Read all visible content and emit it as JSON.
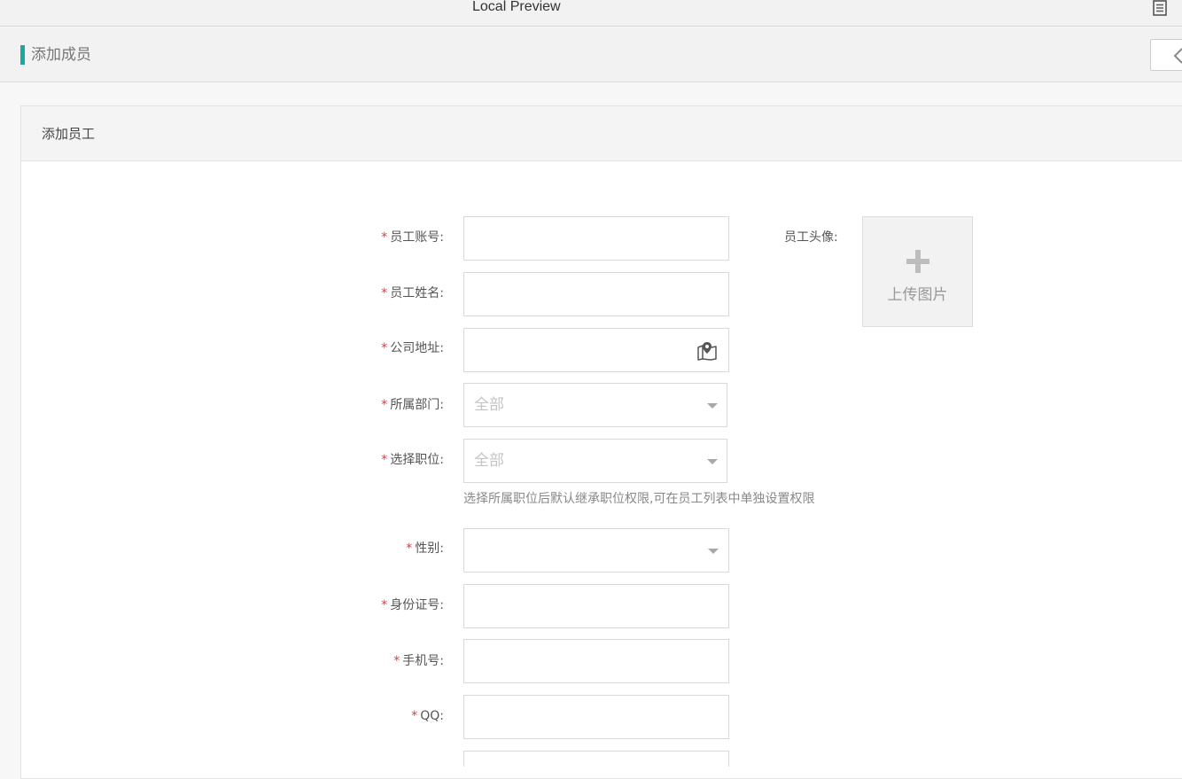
{
  "window": {
    "title": "Local Preview"
  },
  "header": {
    "title": "添加成员"
  },
  "panel": {
    "title": "添加员工"
  },
  "form": {
    "required_mark": "*",
    "account_label": "员工账号:",
    "name_label": "员工姓名:",
    "address_label": "公司地址:",
    "department_label": "所属部门:",
    "department_placeholder": "全部",
    "position_label": "选择职位:",
    "position_placeholder": "全部",
    "position_hint": "选择所属职位后默认继承职位权限,可在员工列表中单独设置权限",
    "gender_label": "性别:",
    "idcard_label": "身份证号:",
    "phone_label": "手机号:",
    "qq_label": "QQ:",
    "avatar_label": "员工头像:",
    "upload_text": "上传图片"
  },
  "icons": {
    "menu": "document-list-icon",
    "back": "chevron-left-icon",
    "map": "map-pin-icon",
    "upload": "plus-icon",
    "dropdown": "caret-down-icon"
  },
  "colors": {
    "accent": "#1aa9a0",
    "required": "#e53935"
  }
}
